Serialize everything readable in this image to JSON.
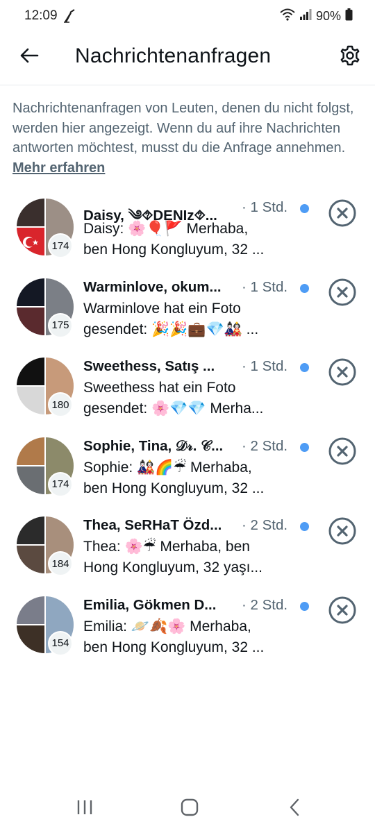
{
  "status_bar": {
    "time": "12:09",
    "battery": "90%",
    "icons": [
      "broom-icon",
      "wifi-icon",
      "signal-icon",
      "battery-icon"
    ]
  },
  "header": {
    "title": "Nachrichtenanfragen",
    "back_icon": "arrow-left-icon",
    "settings_icon": "gear-icon"
  },
  "info": {
    "text": "Nachrichtenanfragen von Leuten, denen du nicht folgst, werden hier angezeigt. Wenn du auf ihre Nachrichten antworten möchtest, musst du die Anfrage annehmen.",
    "link": "Mehr erfahren"
  },
  "requests": [
    {
      "names": "Daisy, ༄⯑DENIz⯑...",
      "time": "· 1 Std.",
      "preview_line1": "Daisy: 🌸🎈🚩 Merhaba,",
      "preview_line2": "ben Hong Kongluyum, 32 ...",
      "count": "174",
      "colors": [
        "#3a2f2d",
        "#9c8f86",
        "#d9252c"
      ]
    },
    {
      "names": "Warminlove, okum...",
      "time": "· 1 Std.",
      "preview_line1": "Warminlove hat ein Foto",
      "preview_line2": "gesendet: 🎉🎉💼💎🎎 ...",
      "count": "175",
      "colors": [
        "#141824",
        "#7b7f86",
        "#5a2a2e"
      ]
    },
    {
      "names": "Sweethess, Satış ...",
      "time": "· 1 Std.",
      "preview_line1": "Sweethess hat ein Foto",
      "preview_line2": "gesendet: 🌸💎💎 Merha...",
      "count": "180",
      "colors": [
        "#111111",
        "#c79a7a",
        "#d8d8d8"
      ]
    },
    {
      "names": "Sophie, Tina, 𝒟𝓇. 𝒞...",
      "time": "· 2 Std.",
      "preview_line1": "Sophie: 🎎🌈☔ Merhaba,",
      "preview_line2": "ben Hong Kongluyum, 32 ...",
      "count": "174",
      "colors": [
        "#b07a4a",
        "#8c8a6a",
        "#6a6e72"
      ]
    },
    {
      "names": "Thea, SeRHaT Özd...",
      "time": "· 2 Std.",
      "preview_line1": "Thea: 🌸☔ Merhaba, ben",
      "preview_line2": "Hong Kongluyum, 32 yaşı...",
      "count": "184",
      "colors": [
        "#2b2b2b",
        "#a88f7c",
        "#5b4a40"
      ]
    },
    {
      "names": "Emilia, Gökmen D...",
      "time": "· 2 Std.",
      "preview_line1": "Emilia: 🪐🍂🌸 Merhaba,",
      "preview_line2": "ben Hong Kongluyum, 32 ...",
      "count": "154",
      "colors": [
        "#7a7d8a",
        "#8fa7c0",
        "#3d3026"
      ]
    }
  ],
  "nav": {
    "items": [
      "recents-icon",
      "home-icon",
      "back-nav-icon"
    ]
  }
}
